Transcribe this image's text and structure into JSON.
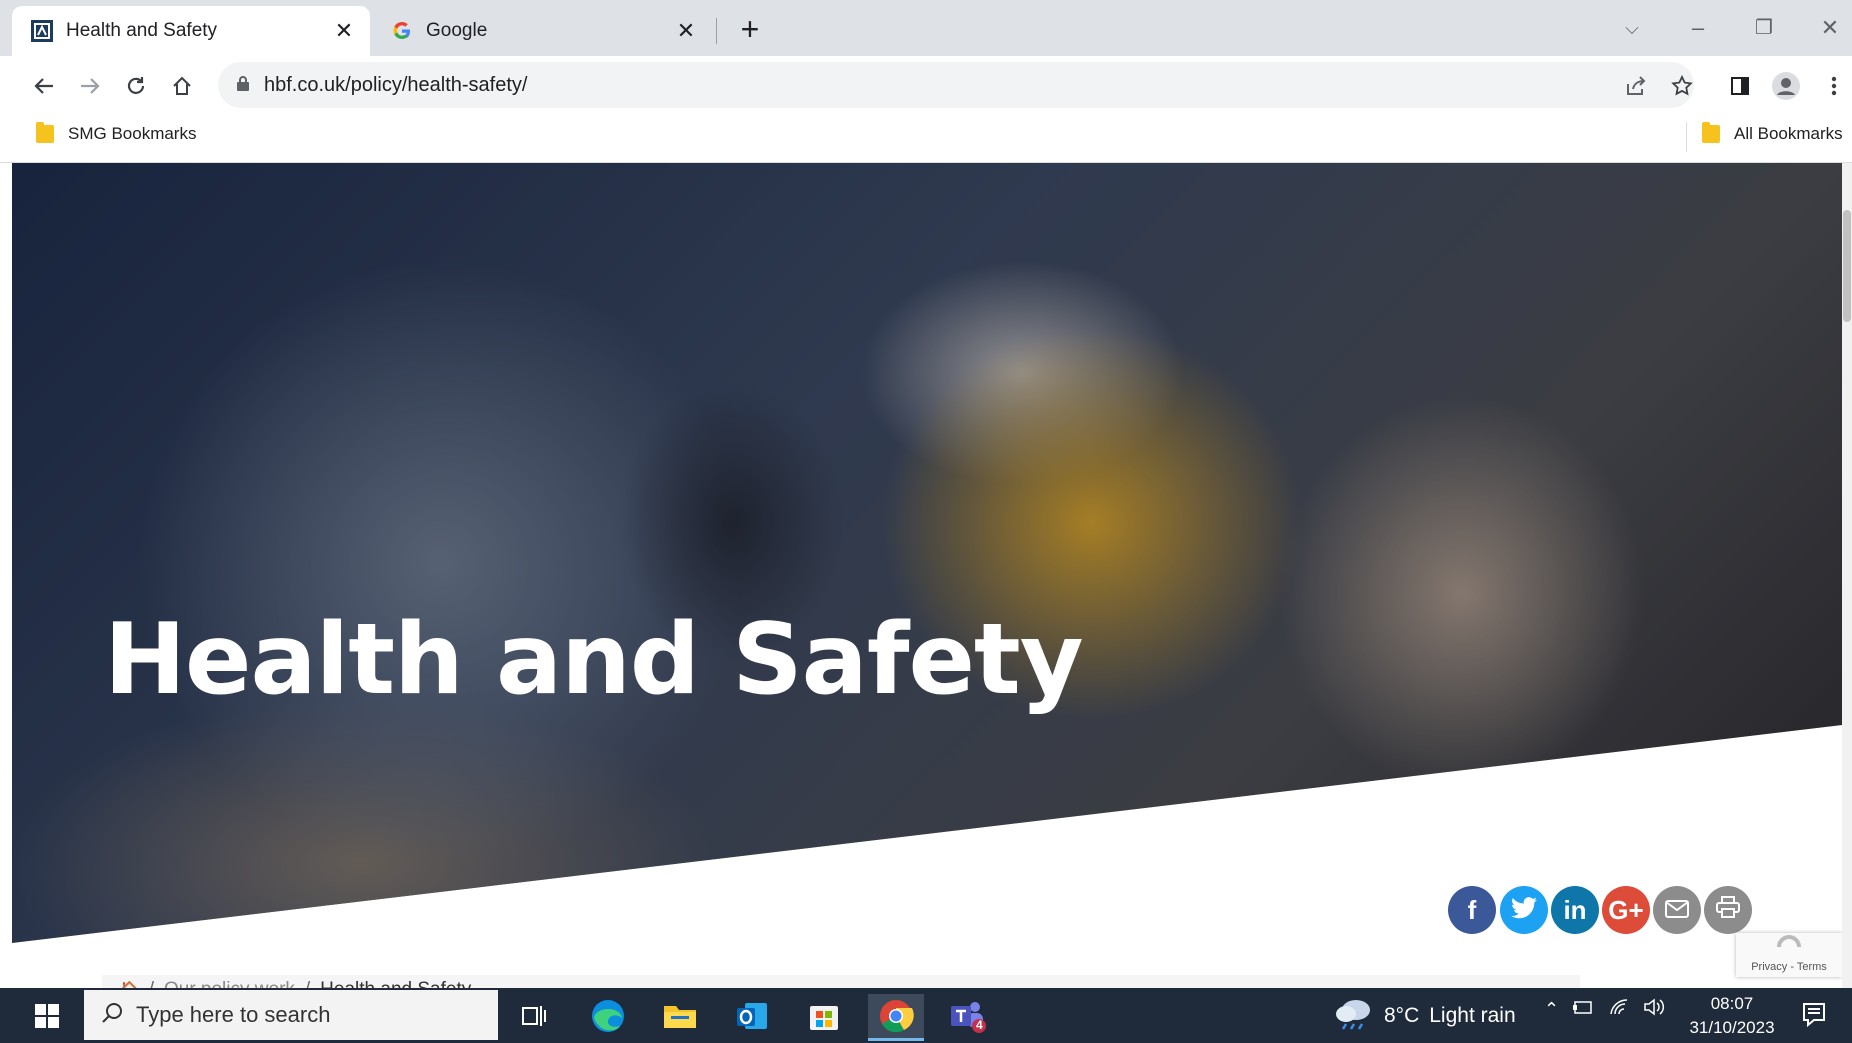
{
  "browser": {
    "tabs": [
      {
        "title": "Health and Safety",
        "active": true,
        "favicon": "hbf-icon"
      },
      {
        "title": "Google",
        "active": false,
        "favicon": "google-icon"
      }
    ],
    "url": "hbf.co.uk/policy/health-safety/",
    "bookmarks": {
      "left": "SMG Bookmarks",
      "right": "All Bookmarks"
    }
  },
  "page": {
    "hero_title": "Health and Safety",
    "share_buttons": [
      {
        "name": "facebook",
        "glyph": "f",
        "color": "#3b5998"
      },
      {
        "name": "twitter",
        "glyph": "t",
        "color": "#1da1f2"
      },
      {
        "name": "linkedin",
        "glyph": "in",
        "color": "#0e76a8"
      },
      {
        "name": "google-plus",
        "glyph": "G+",
        "color": "#dd4b39"
      },
      {
        "name": "email",
        "glyph": "✉",
        "color": "#8c8c8c"
      },
      {
        "name": "print",
        "glyph": "⎙",
        "color": "#8c8c8c"
      }
    ],
    "breadcrumb": {
      "home_glyph": "🏠",
      "sep": "/",
      "items": [
        "Our policy work",
        "Health and Safety"
      ]
    },
    "recaptcha": "Privacy - Terms"
  },
  "taskbar": {
    "search_placeholder": "Type here to search",
    "weather": {
      "temp": "8°C",
      "condition": "Light rain"
    },
    "time": "08:07",
    "date": "31/10/2023",
    "teams_badge": "4"
  },
  "colors": {
    "tabstrip": "#dee1e6",
    "taskbar": "#1f2a3a",
    "folder": "#f6c21d"
  }
}
